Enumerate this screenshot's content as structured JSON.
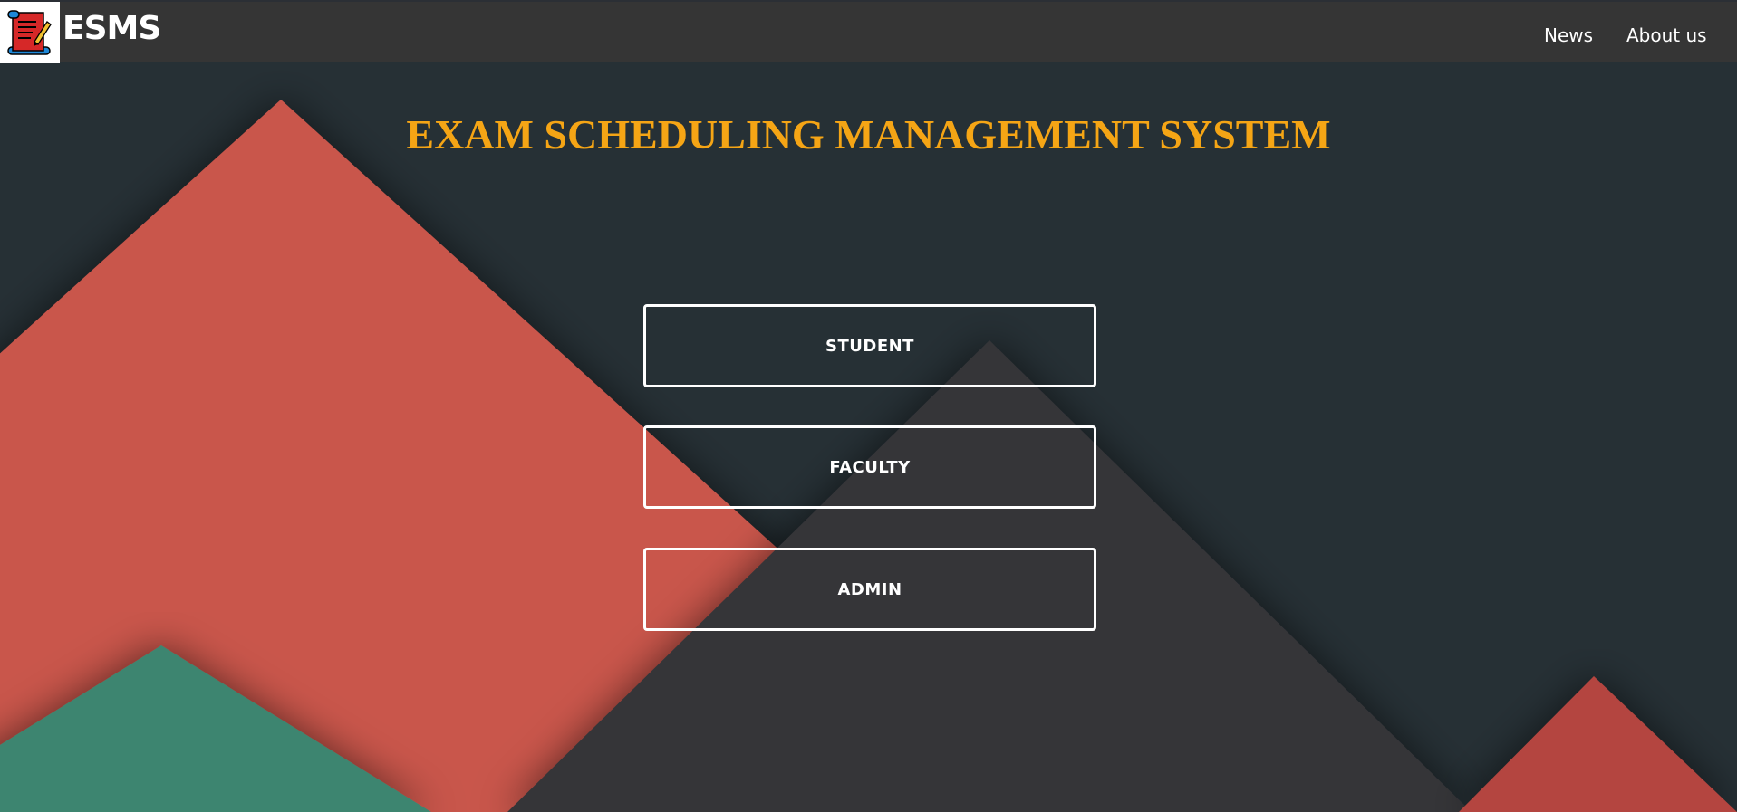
{
  "navbar": {
    "brand": "ESMS",
    "logo_icon": "scroll-pen-icon",
    "links": [
      {
        "label": "News"
      },
      {
        "label": "About us"
      }
    ]
  },
  "main": {
    "title": "EXAM SCHEDULING MANAGEMENT SYSTEM",
    "buttons": [
      {
        "label": "STUDENT"
      },
      {
        "label": "FACULTY"
      },
      {
        "label": "ADMIN"
      }
    ]
  },
  "colors": {
    "background": "#263035",
    "navbar": "#353535",
    "title": "#f5a515",
    "red_mountain": "#c9564b",
    "gray_mountain": "#353539",
    "green_mountain": "#3e8570",
    "dark_red_mountain": "#b4443f"
  }
}
